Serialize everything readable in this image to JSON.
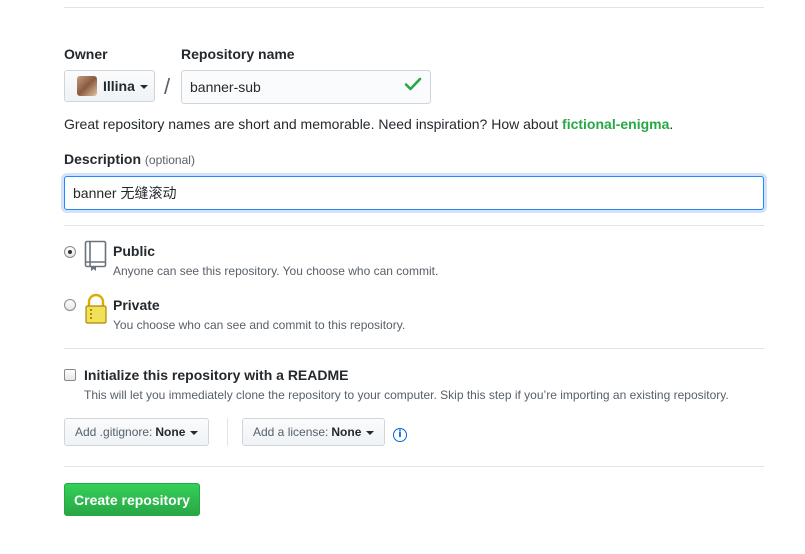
{
  "form": {
    "owner_label": "Owner",
    "owner_value": "Illina",
    "separator": "/",
    "repo_name_label": "Repository name",
    "repo_name_value": "banner-sub",
    "hint_prefix": "Great repository names are short and memorable. Need inspiration? How about ",
    "hint_suggestion": "fictional-enigma",
    "hint_suffix": ".",
    "description_label": "Description",
    "description_optional": "(optional)",
    "description_value": "banner 无缝滚动"
  },
  "visibility": {
    "selected": "public",
    "options": [
      {
        "title": "Public",
        "note": "Anyone can see this repository. You choose who can commit."
      },
      {
        "title": "Private",
        "note": "You choose who can see and commit to this repository."
      }
    ]
  },
  "init": {
    "readme_label": "Initialize this repository with a README",
    "readme_note": "This will let you immediately clone the repository to your computer. Skip this step if you’re importing an existing repository.",
    "readme_checked": false,
    "gitignore_label": "Add .gitignore:",
    "gitignore_value": "None",
    "license_label": "Add a license:",
    "license_value": "None"
  },
  "actions": {
    "create_label": "Create repository"
  },
  "colors": {
    "accent_green": "#28a745",
    "focus_blue": "#2188ff",
    "link_blue": "#0366d6"
  },
  "icons": [
    "caret-down-icon",
    "check-icon",
    "repo-book-icon",
    "lock-icon",
    "info-icon"
  ]
}
